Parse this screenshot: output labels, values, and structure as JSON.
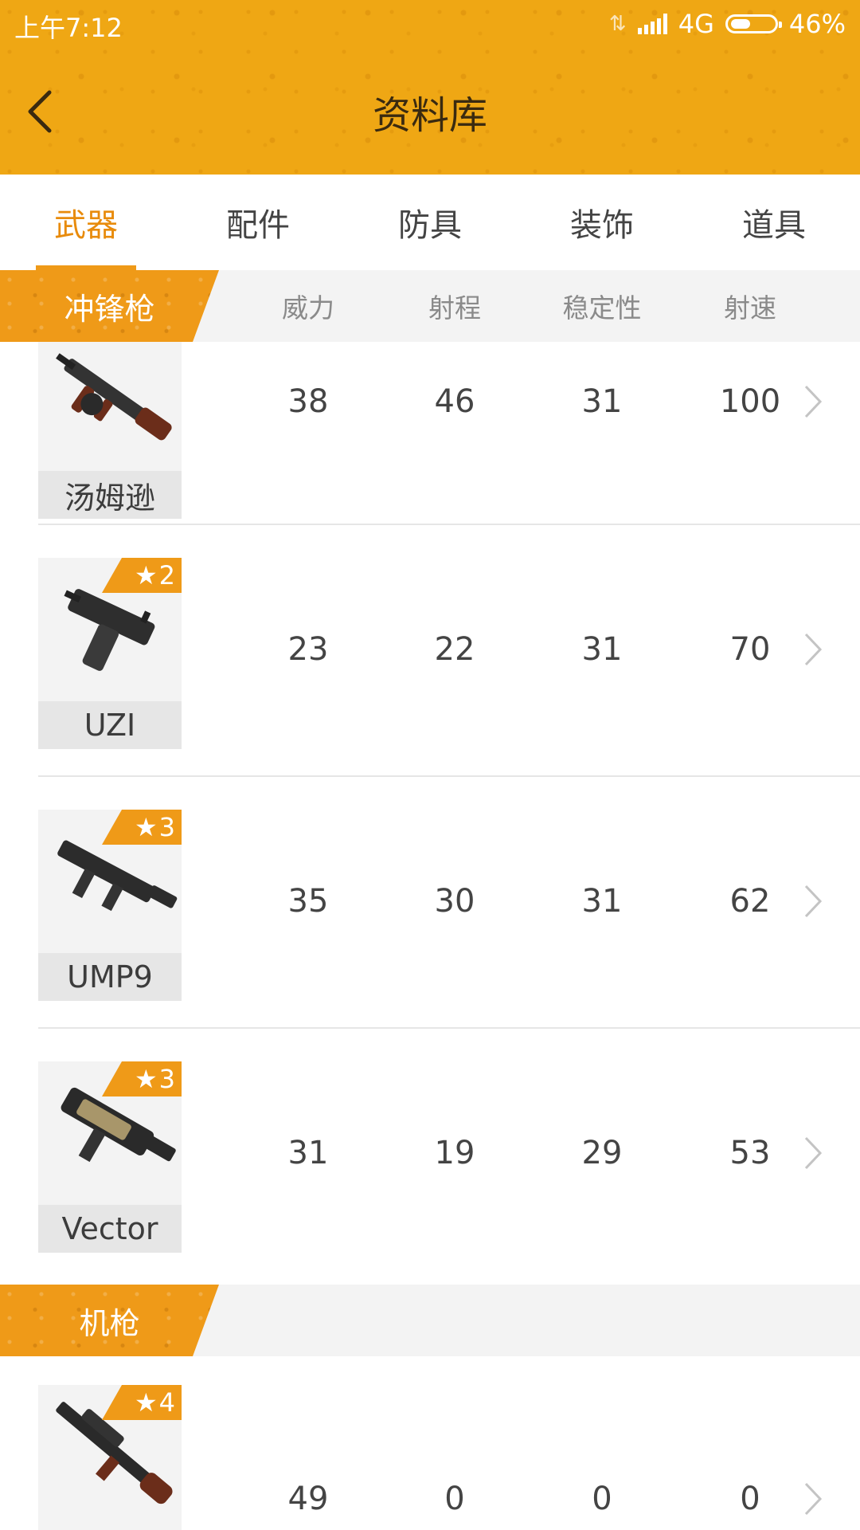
{
  "status_bar": {
    "time": "上午7:12",
    "network": "4G",
    "battery": "46%",
    "battery_level": 0.46
  },
  "header": {
    "title": "资料库"
  },
  "tabs": [
    {
      "label": "武器",
      "active": true
    },
    {
      "label": "配件",
      "active": false
    },
    {
      "label": "防具",
      "active": false
    },
    {
      "label": "装饰",
      "active": false
    },
    {
      "label": "道具",
      "active": false
    }
  ],
  "columns": [
    "威力",
    "射程",
    "稳定性",
    "射速"
  ],
  "categories": [
    {
      "name": "冲锋枪",
      "items": [
        {
          "name": "汤姆逊",
          "stars": "",
          "stats": [
            "38",
            "46",
            "31",
            "100"
          ]
        },
        {
          "name": "UZI",
          "stars": "2",
          "stats": [
            "23",
            "22",
            "31",
            "70"
          ]
        },
        {
          "name": "UMP9",
          "stars": "3",
          "stats": [
            "35",
            "30",
            "31",
            "62"
          ]
        },
        {
          "name": "Vector",
          "stars": "3",
          "stats": [
            "31",
            "19",
            "29",
            "53"
          ]
        }
      ]
    },
    {
      "name": "机枪",
      "items": [
        {
          "name": "",
          "stars": "4",
          "stats": [
            "49",
            "0",
            "0",
            "0"
          ]
        }
      ]
    }
  ],
  "colors": {
    "accent": "#ef9a18",
    "header": "#efa714",
    "tab_active": "#e88b0c"
  }
}
